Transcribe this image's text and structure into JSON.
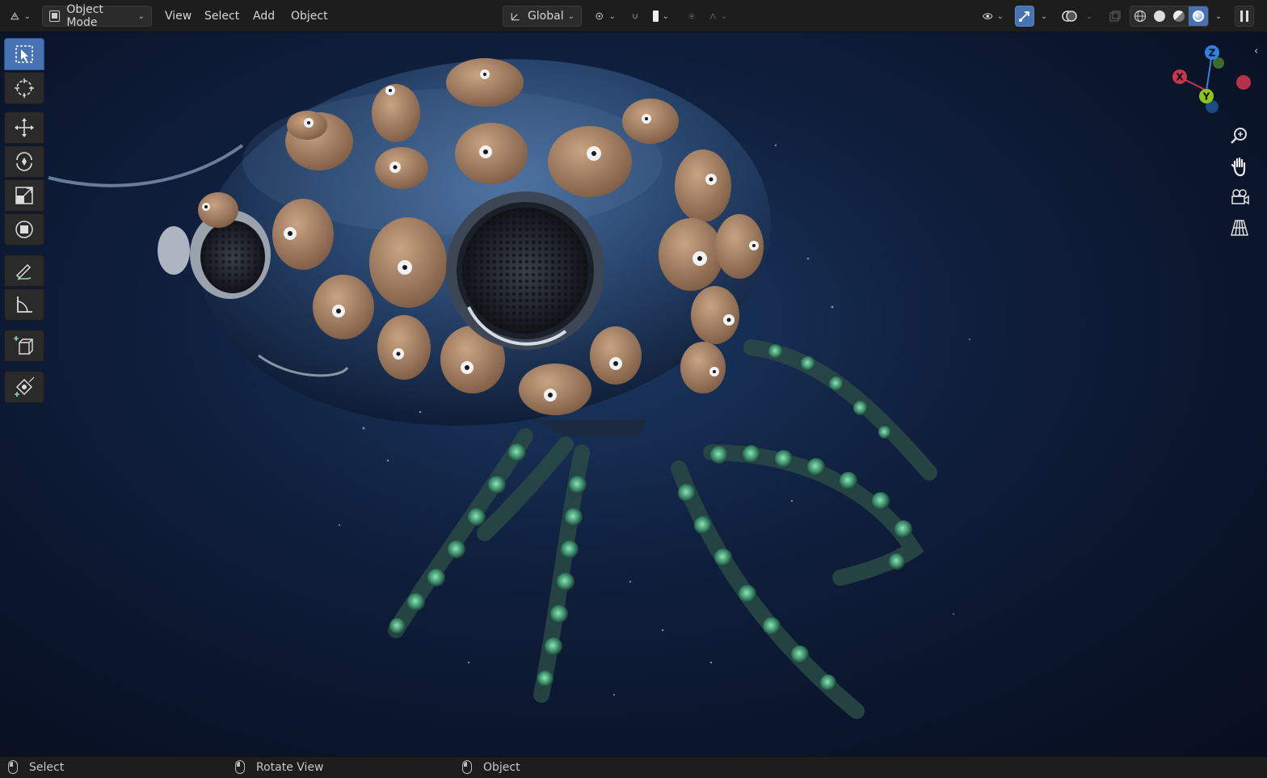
{
  "header": {
    "editor_type_icon": "axes-grid-icon",
    "mode_label": "Object Mode",
    "menus": [
      "View",
      "Select",
      "Add",
      "Object"
    ],
    "transform_orientation": "Global",
    "pivot_icon": "pivot-point-icon",
    "snap_icon": "snap-magnet-icon",
    "proportional_icon": "proportional-editing-icon",
    "visibility_icon": "eye-icon",
    "gizmo_icon": "gizmo-toggle-icon",
    "overlay_icon": "overlay-icon",
    "xray_icon": "xray-icon",
    "shading_modes": [
      "wireframe",
      "solid",
      "material-preview",
      "rendered"
    ],
    "active_shading": "rendered"
  },
  "toolbar": {
    "tools": [
      {
        "name": "select-box",
        "icon": "select-box-icon",
        "active": true
      },
      {
        "name": "cursor",
        "icon": "cursor-icon",
        "active": false
      },
      {
        "name": "move",
        "icon": "move-icon",
        "active": false
      },
      {
        "name": "rotate",
        "icon": "rotate-icon",
        "active": false
      },
      {
        "name": "scale",
        "icon": "scale-icon",
        "active": false
      },
      {
        "name": "transform",
        "icon": "transform-icon",
        "active": false
      },
      {
        "name": "annotate",
        "icon": "annotate-icon",
        "active": false
      },
      {
        "name": "measure",
        "icon": "measure-icon",
        "active": false
      },
      {
        "name": "add-cube",
        "icon": "add-cube-icon",
        "active": false
      },
      {
        "name": "add-object",
        "icon": "add-object-icon",
        "active": false
      }
    ]
  },
  "navigation_gizmo": {
    "axes": [
      "Z",
      "X",
      "Y"
    ],
    "colors": {
      "x": "#c8364e",
      "y": "#8bc61b",
      "z": "#2f83e0"
    }
  },
  "nav_buttons": [
    "zoom-icon",
    "pan-hand-icon",
    "camera-icon",
    "grid-perspective-icon"
  ],
  "colors": {
    "accent": "#4772b3",
    "header_bg": "#1d1d1d",
    "viewport_bg": "#0f1f3d"
  },
  "status_bar": {
    "items": [
      {
        "label": "Select",
        "icon": "mouse-left-icon"
      },
      {
        "label": "Rotate View",
        "icon": "mouse-middle-icon"
      },
      {
        "label": "Object",
        "icon": "mouse-right-icon"
      }
    ]
  }
}
